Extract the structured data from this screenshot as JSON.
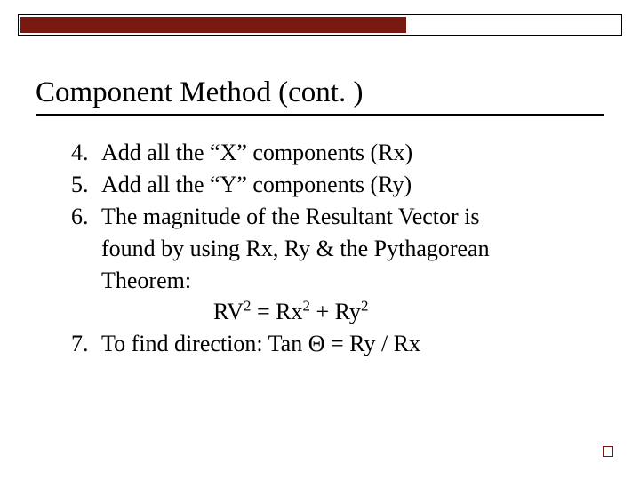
{
  "title": "Component Method (cont. )",
  "items": {
    "n4": "4.",
    "t4": "Add all the “X” components (Rx)",
    "n5": "5.",
    "t5": "Add all the “Y” components (Ry)",
    "n6": "6.",
    "t6a": "The magnitude of the Resultant Vector is",
    "t6b": "found by using Rx, Ry & the Pythagorean",
    "t6c": "Theorem:",
    "eq_rv": "RV",
    "eq_eq1": " = Rx",
    "eq_plus": " + Ry",
    "sup2": "2",
    "n7": "7.",
    "t7": "To find direction: Tan Θ = Ry / Rx"
  }
}
